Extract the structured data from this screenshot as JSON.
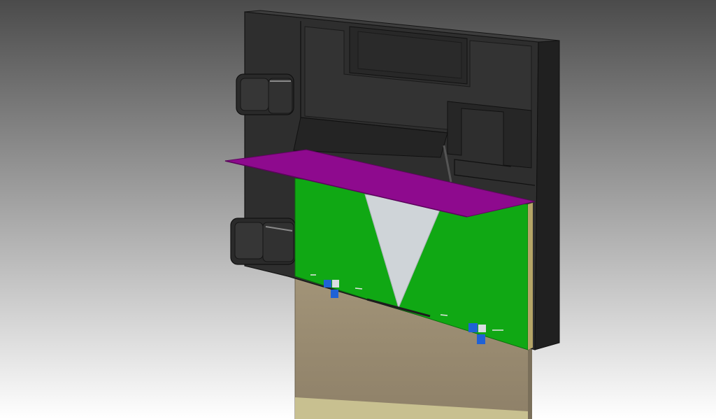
{
  "viewport": {
    "background_top": "#4b4b4b",
    "background_bottom": "#ffffff"
  },
  "model": {
    "housing_color": "#2e2e2e",
    "housing_edge_color": "#151515",
    "housing_highlight_color": "#4a4a4a",
    "shelf_color": "#8e0a8e",
    "board_color": "#10a814",
    "cutout_color": "#cfd4d8",
    "strip_color": "#9a8c74",
    "strip_foot_color": "#c8c090",
    "marker_color": "#1f62d6"
  }
}
